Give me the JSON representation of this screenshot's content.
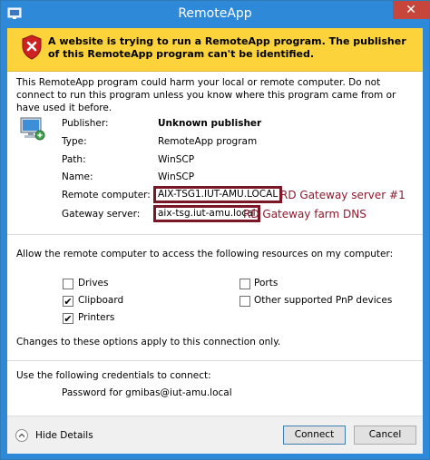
{
  "window": {
    "title": "RemoteApp"
  },
  "warning": {
    "text": "A website is trying to run a RemoteApp program. The publisher of this RemoteApp program can't be identified."
  },
  "intro": "This RemoteApp program could harm your local or remote computer. Do not connect to run this program unless you know where this program came from or have used it before.",
  "details": {
    "publisher_label": "Publisher:",
    "publisher_value": "Unknown publisher",
    "type_label": "Type:",
    "type_value": "RemoteApp program",
    "path_label": "Path:",
    "path_value": "WinSCP",
    "name_label": "Name:",
    "name_value": "WinSCP",
    "remote_label": "Remote computer:",
    "remote_value": "AIX-TSG1.IUT-AMU.LOCAL",
    "gateway_label": "Gateway server:",
    "gateway_value": "aix-tsg.iut-amu.local"
  },
  "annotations": {
    "remote": "RD Gateway server #1",
    "gateway": "RD Gateway farm DNS"
  },
  "resources": {
    "heading": "Allow the remote computer to access the following resources on my computer:",
    "drives": {
      "label": "Drives",
      "checked": false
    },
    "clipboard": {
      "label": "Clipboard",
      "checked": true
    },
    "printers": {
      "label": "Printers",
      "checked": true
    },
    "ports": {
      "label": "Ports",
      "checked": false
    },
    "pnp": {
      "label": "Other supported PnP devices",
      "checked": false
    },
    "note": "Changes to these options apply to this connection only."
  },
  "credentials": {
    "heading": "Use the following credentials to connect:",
    "value": "Password for gmibas@iut-amu.local"
  },
  "footer": {
    "hide_details": "Hide Details",
    "connect": "Connect",
    "cancel": "Cancel"
  },
  "colors": {
    "titlebar": "#2e8ad8",
    "warning": "#fcd33b",
    "annotation": "#8b1a2e",
    "close": "#c7463c"
  },
  "icons": {
    "app": "remoteapp-icon",
    "close": "close-icon",
    "shield": "shield-error-icon",
    "computer": "computer-icon",
    "check": "check-icon",
    "chevron": "chevron-up-icon"
  }
}
